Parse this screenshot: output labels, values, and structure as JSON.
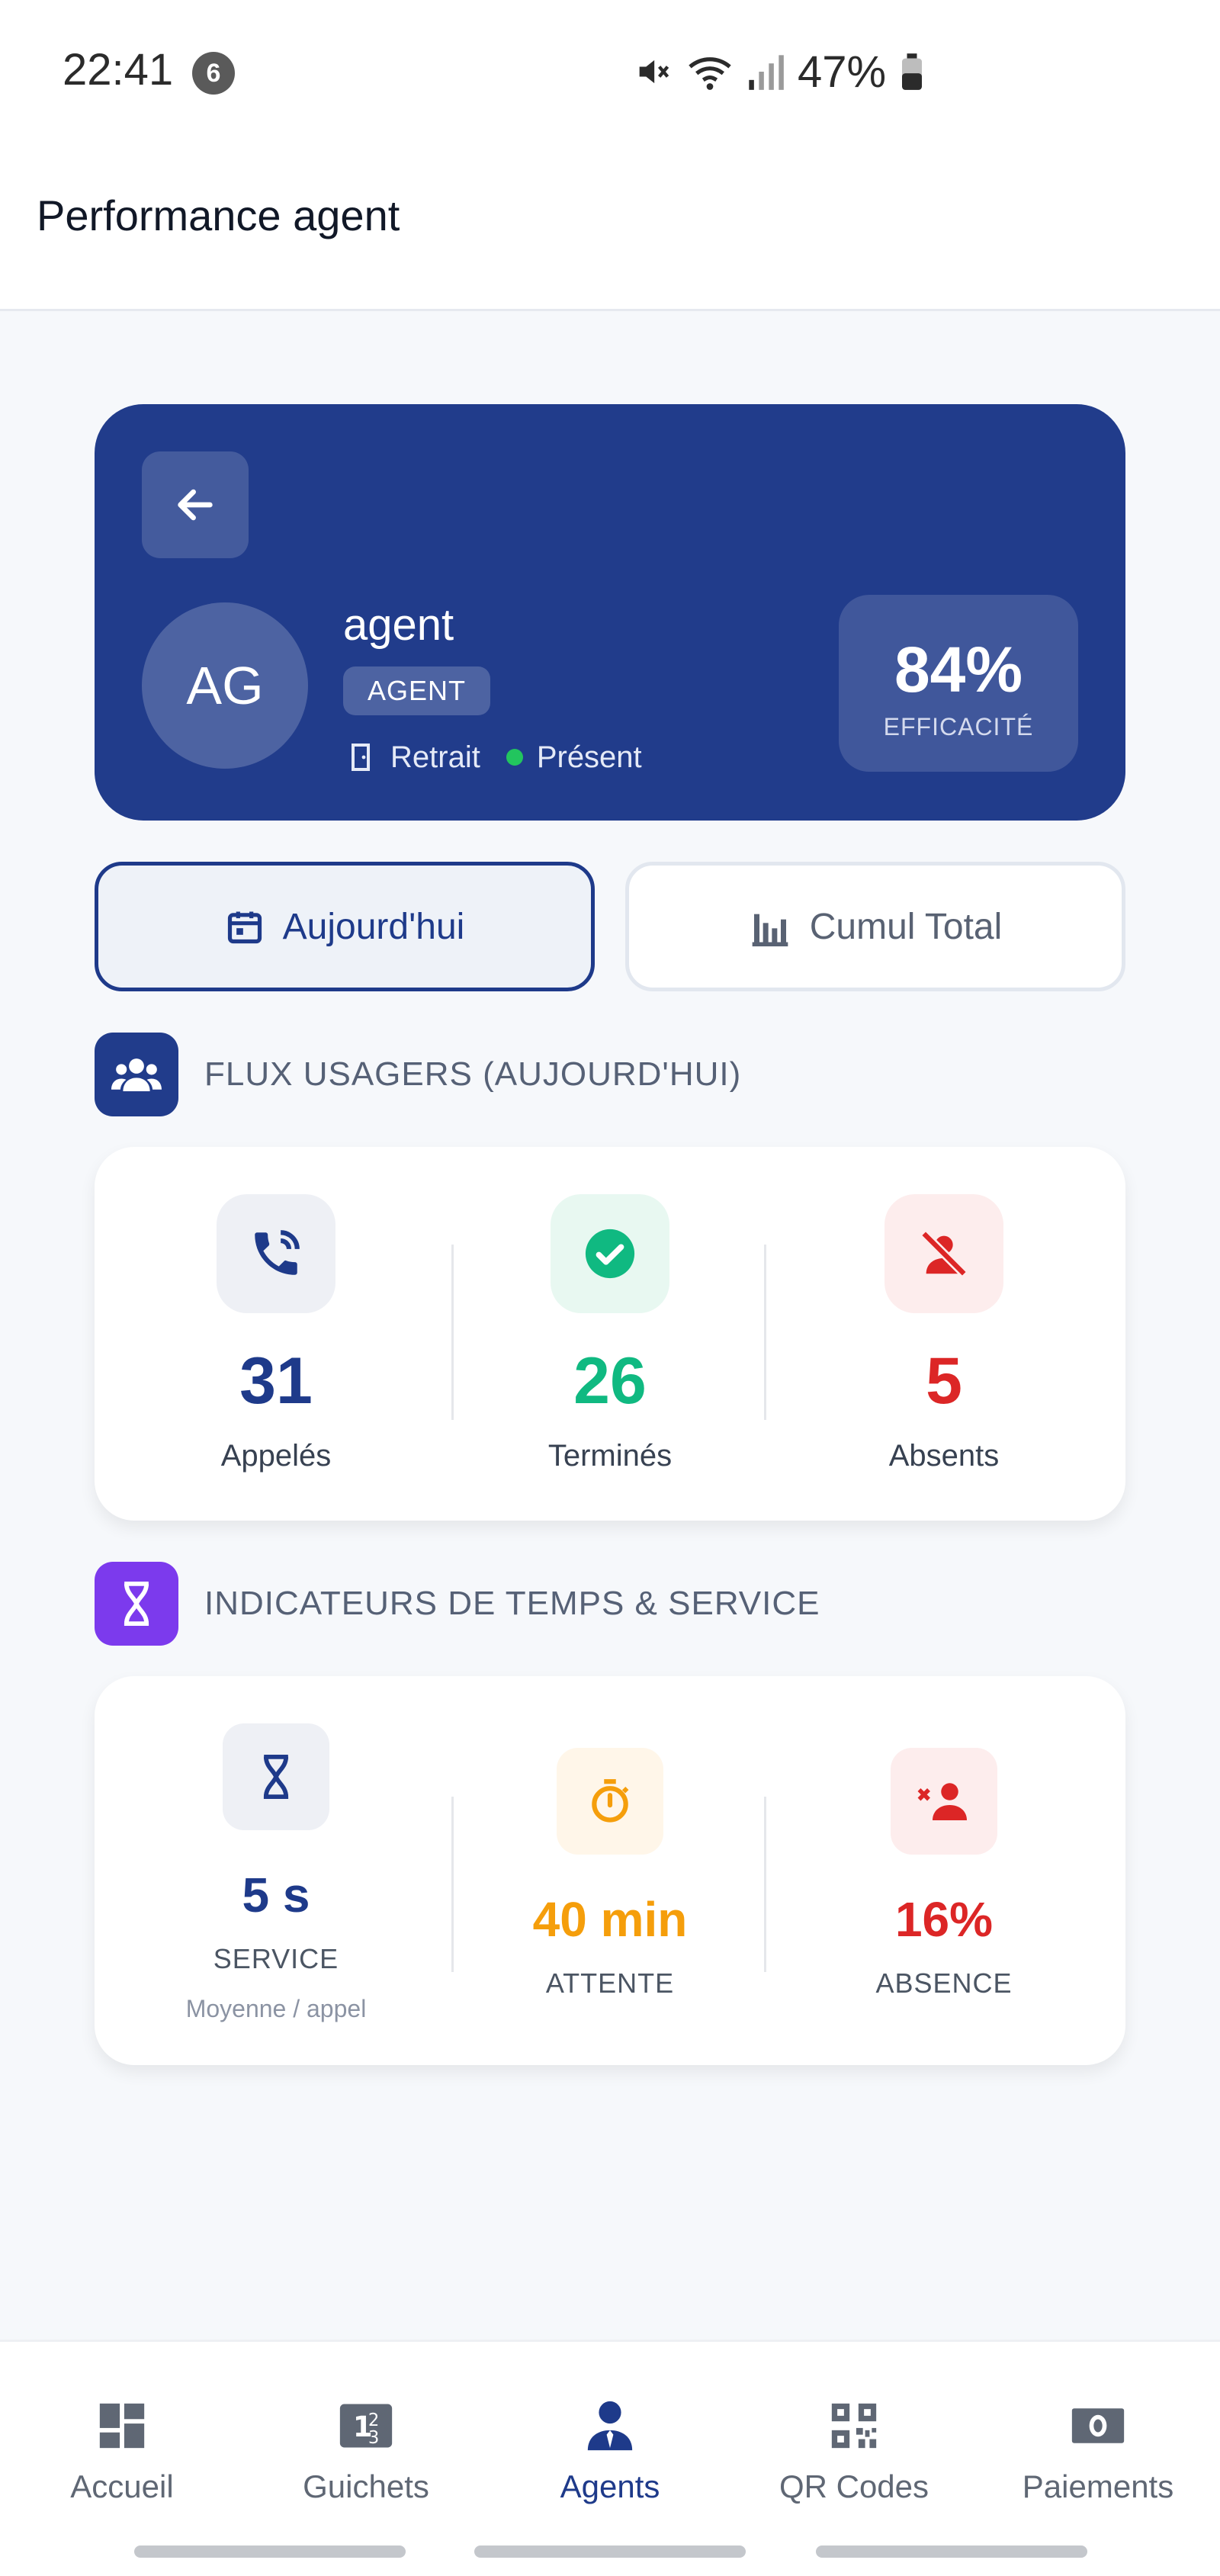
{
  "status_bar": {
    "time": "22:41",
    "notification_count": "6",
    "battery": "47%"
  },
  "header": {
    "title": "Performance agent"
  },
  "profile": {
    "initials": "AG",
    "name": "agent",
    "role": "AGENT",
    "counter": "Retrait",
    "presence": "Présent",
    "efficiency_value": "84%",
    "efficiency_label": "EFFICACITÉ"
  },
  "tabs": {
    "today": "Aujourd'hui",
    "total": "Cumul Total",
    "selected": "today"
  },
  "flux": {
    "title": "FLUX USAGERS (AUJOURD'HUI)",
    "stats": [
      {
        "value": "31",
        "label": "Appelés",
        "color": "#1E3A8A",
        "icon": "phone-call-icon"
      },
      {
        "value": "26",
        "label": "Terminés",
        "color": "#10B981",
        "icon": "check-circle-icon"
      },
      {
        "value": "5",
        "label": "Absents",
        "color": "#DC2626",
        "icon": "user-off-icon"
      }
    ]
  },
  "time_service": {
    "title": "INDICATEURS DE TEMPS & SERVICE",
    "stats": [
      {
        "value": "5 s",
        "label": "SERVICE",
        "sub": "Moyenne / appel",
        "color": "#1E3A8A",
        "icon": "hourglass-icon"
      },
      {
        "value": "40 min",
        "label": "ATTENTE",
        "color": "#F59E0B",
        "icon": "stopwatch-icon"
      },
      {
        "value": "16%",
        "label": "ABSENCE",
        "color": "#DC2626",
        "icon": "user-remove-icon"
      }
    ]
  },
  "bottom_nav": {
    "items": [
      {
        "label": "Accueil",
        "icon": "dashboard-icon"
      },
      {
        "label": "Guichets",
        "icon": "counter-icon"
      },
      {
        "label": "Agents",
        "icon": "agent-icon"
      },
      {
        "label": "QR Codes",
        "icon": "qr-code-icon"
      },
      {
        "label": "Paiements",
        "icon": "payments-icon"
      }
    ],
    "active": "Agents"
  },
  "colors": {
    "primary": "#213C8B",
    "success": "#10B981",
    "danger": "#DC2626",
    "warning": "#F59E0B",
    "purple": "#7C3AED"
  }
}
